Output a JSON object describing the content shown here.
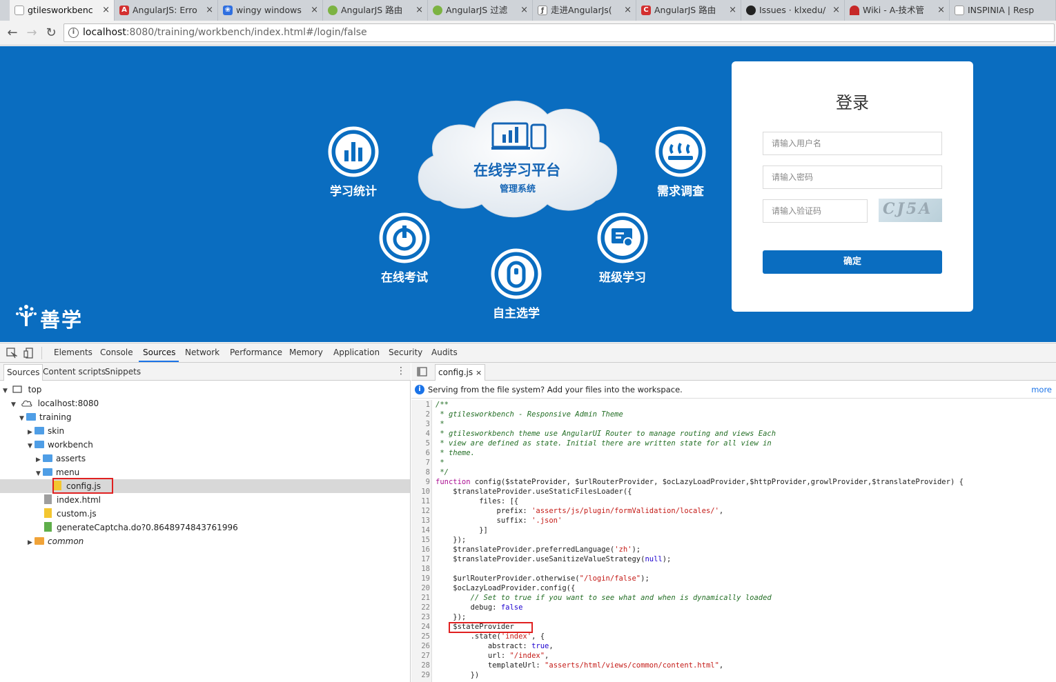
{
  "browser": {
    "tabs": [
      {
        "title": "gtilesworkbenc",
        "active": true,
        "icon": "page-icon"
      },
      {
        "title": "AngularJS: Erro",
        "icon": "angular-icon"
      },
      {
        "title": "wingy windows",
        "icon": "baidu-paw-icon"
      },
      {
        "title": "AngularJS 路由",
        "icon": "runoob-icon"
      },
      {
        "title": "AngularJS 过滤",
        "icon": "runoob-icon"
      },
      {
        "title": "走进AngularJs(",
        "icon": "stack-icon"
      },
      {
        "title": "AngularJS 路由",
        "icon": "csdn-icon"
      },
      {
        "title": "Issues · klxedu/",
        "icon": "github-icon"
      },
      {
        "title": "Wiki - A-技术管",
        "icon": "gitee-icon"
      },
      {
        "title": "INSPINIA | Resp",
        "icon": "page-icon"
      }
    ],
    "url_host": "localhost",
    "url_rest": ":8080/training/workbench/index.html#/login/false"
  },
  "page": {
    "cloud_title": "在线学习平台",
    "cloud_subtitle": "管理系统",
    "features": [
      "学习统计",
      "需求调查",
      "在线考试",
      "班级学习",
      "自主选学"
    ],
    "logo_text": "善学",
    "login": {
      "title": "登录",
      "username_placeholder": "请输入用户名",
      "password_placeholder": "请输入密码",
      "captcha_placeholder": "请输入验证码",
      "captcha_text": "CJ5A",
      "submit": "确定"
    }
  },
  "devtools": {
    "tabs": [
      "Elements",
      "Console",
      "Sources",
      "Network",
      "Performance",
      "Memory",
      "Application",
      "Security",
      "Audits"
    ],
    "active_tab": "Sources",
    "nav_tabs": [
      "Sources",
      "Content scripts",
      "Snippets"
    ],
    "tree": [
      {
        "label": "top",
        "type": "frame"
      },
      {
        "label": "localhost:8080",
        "type": "cloud"
      },
      {
        "label": "training",
        "type": "folder"
      },
      {
        "label": "skin",
        "type": "folder"
      },
      {
        "label": "workbench",
        "type": "folder"
      },
      {
        "label": "asserts",
        "type": "folder"
      },
      {
        "label": "menu",
        "type": "folder"
      },
      {
        "label": "config.js",
        "type": "js"
      },
      {
        "label": "index.html",
        "type": "html"
      },
      {
        "label": "custom.js",
        "type": "js"
      },
      {
        "label": "generateCaptcha.do?0.8648974843761996",
        "type": "image"
      },
      {
        "label": "common",
        "type": "folder"
      }
    ],
    "open_file": "config.js",
    "info_message": "Serving from the file system? Add your files into the workspace.",
    "info_more": "more",
    "code_lines": [
      "/**",
      " * gtilesworkbench - Responsive Admin Theme",
      " *",
      " * gtilesworkbench theme use AngularUI Router to manage routing and views Each",
      " * view are defined as state. Initial there are written state for all view in",
      " * theme.",
      " *",
      " */",
      "function config($stateProvider, $urlRouterProvider, $ocLazyLoadProvider,$httpProvider,growlProvider,$translateProvider) {",
      "    $translateProvider.useStaticFilesLoader({",
      "          files: [{",
      "              prefix: 'asserts/js/plugin/formValidation/locales/',",
      "              suffix: '.json'",
      "          }]",
      "    });",
      "    $translateProvider.preferredLanguage('zh');",
      "    $translateProvider.useSanitizeValueStrategy(null);",
      "",
      "    $urlRouterProvider.otherwise(\"/login/false\");",
      "    $ocLazyLoadProvider.config({",
      "        // Set to true if you want to see what and when is dynamically loaded",
      "        debug: false",
      "    });",
      "    $stateProvider",
      "        .state('index', {",
      "            abstract: true,",
      "            url: \"/index\",",
      "            templateUrl: \"asserts/html/views/common/content.html\",",
      "        })"
    ]
  }
}
